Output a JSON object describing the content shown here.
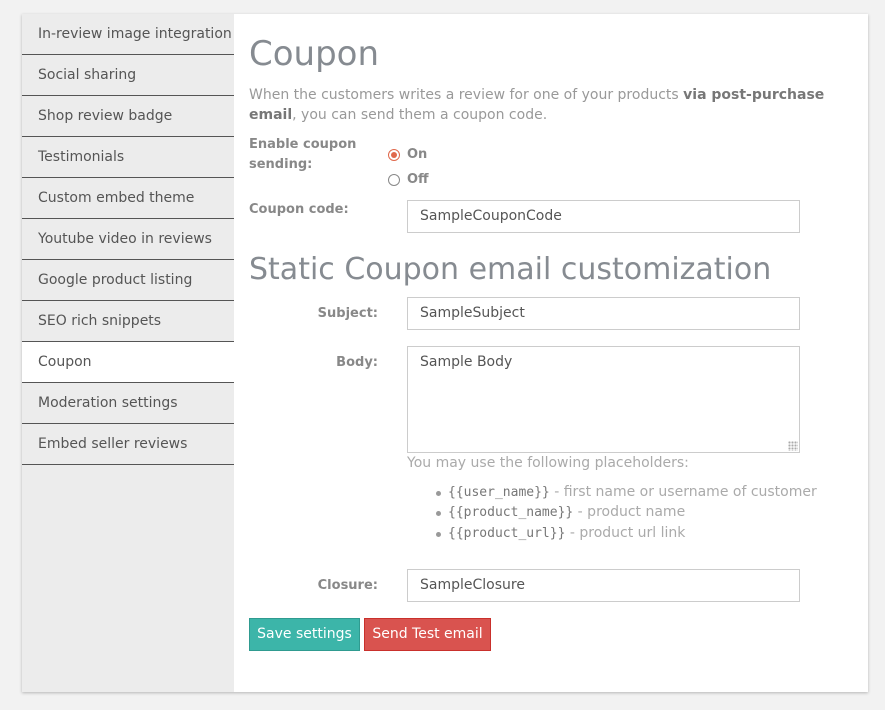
{
  "sidebar": {
    "items": [
      {
        "label": "In-review image integration"
      },
      {
        "label": "Social sharing"
      },
      {
        "label": "Shop review badge"
      },
      {
        "label": "Testimonials"
      },
      {
        "label": "Custom embed theme"
      },
      {
        "label": "Youtube video in reviews"
      },
      {
        "label": "Google product listing"
      },
      {
        "label": "SEO rich snippets"
      },
      {
        "label": "Coupon",
        "active": true
      },
      {
        "label": "Moderation settings"
      },
      {
        "label": "Embed seller reviews"
      }
    ]
  },
  "main": {
    "title": "Coupon",
    "description_part1": "When the customers writes a review for one of your products ",
    "description_bold": "via post-purchase email",
    "description_part2": ", you can send them a coupon code.",
    "enable_label_line1": "Enable coupon",
    "enable_label_line2": "sending:",
    "radio_on": "On",
    "radio_off": "Off",
    "radio_selected": "On",
    "coupon_code_label": "Coupon code:",
    "coupon_code_value": "SampleCouponCode",
    "section_title": "Static Coupon email customization",
    "subject_label": "Subject:",
    "subject_value": "SampleSubject",
    "body_label": "Body:",
    "body_value": "Sample Body",
    "placeholders_hint": "You may use the following placeholders:",
    "placeholders": [
      {
        "code": "{{user_name}}",
        "desc": " - first name or username of customer"
      },
      {
        "code": "{{product_name}}",
        "desc": " - product name"
      },
      {
        "code": "{{product_url}}",
        "desc": " - product url link"
      }
    ],
    "closure_label": "Closure:",
    "closure_value": "SampleClosure",
    "save_button": "Save settings",
    "test_button": "Send Test email"
  },
  "colors": {
    "accent_save": "#3cb5a9",
    "accent_test": "#d9534f",
    "radio_checked": "#e0684b"
  }
}
